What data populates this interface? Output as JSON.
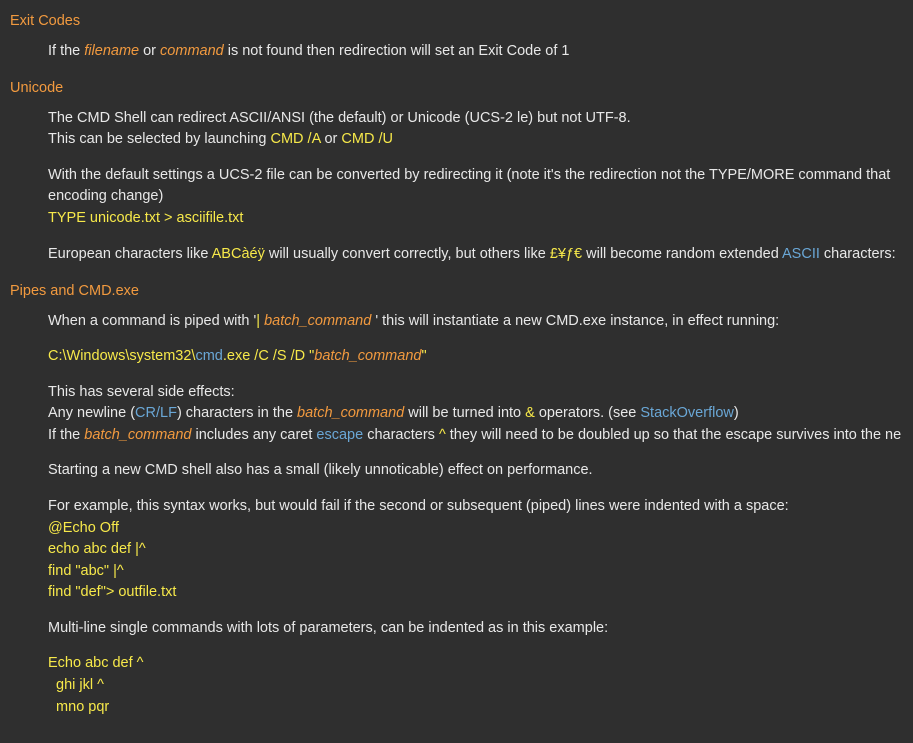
{
  "sections": {
    "exitCodes": {
      "title": "Exit Codes",
      "line1_a": "If the ",
      "filename": "filename",
      "line1_b": " or ",
      "command": "command",
      "line1_c": " is not found then redirection will set an Exit Code of 1"
    },
    "unicode": {
      "title": "Unicode",
      "p1": "The CMD Shell can redirect ASCII/ANSI (the default) or Unicode (UCS-2 le) but not UTF-8.",
      "p2_a": "This can be selected by launching ",
      "p2_cmdA": "CMD /A",
      "p2_or": " or ",
      "p2_cmdU": "CMD /U",
      "p3": "With the default settings a UCS-2 file can be converted by redirecting it (note it's the redirection not the TYPE/MORE command that",
      "p3b": "encoding change)",
      "typeLine": "TYPE unicode.txt > asciifile.txt",
      "p4_a": "European characters like ",
      "p4_abc": "ABCàéÿ",
      "p4_b": " will usually convert correctly, but others like ",
      "p4_cur": "£¥ƒ€",
      "p4_c": " will become random extended ",
      "p4_ascii": "ASCII",
      "p4_d": " characters: "
    },
    "pipes": {
      "title": "Pipes and CMD.exe",
      "p1_a": "When a command is piped with '",
      "p1_pipe": "| ",
      "p1_bc": "batch_command ",
      "p1_b": "' this will instantiate a new CMD.exe instance, in effect running:",
      "cmdline_a": "C:\\Windows\\system32\\",
      "cmdline_cmd": "cmd",
      "cmdline_b": ".exe /C /S /D \"",
      "cmdline_bc": "batch_command",
      "cmdline_c": "\"",
      "p2": "This has several side effects:",
      "p3_a": "Any newline (",
      "p3_crlf": "CR/LF",
      "p3_b": ") characters in the ",
      "p3_bc": "batch_command",
      "p3_c": " will be turned into ",
      "p3_amp": "&",
      "p3_d": " operators. (see ",
      "p3_so": "StackOverflow",
      "p3_e": ")",
      "p4_a": "If the ",
      "p4_bc": "batch_command",
      "p4_b": " includes any caret ",
      "p4_esc": "escape",
      "p4_c": " characters ",
      "p4_caret": "^",
      "p4_d": " they will need to be doubled up so that the escape survives into the ne",
      "p5": "Starting a new CMD shell also has a small (likely unnoticable) effect on performance.",
      "p6": "For example, this syntax works, but would fail if the second or subsequent (piped) lines were indented with a space:",
      "code1_l1": "@Echo Off",
      "code1_l2": "echo abc def |^",
      "code1_l3": "find \"abc\" |^",
      "code1_l4": "find \"def\"> outfile.txt",
      "p7": "Multi-line single commands with lots of parameters, can be indented as in this example:",
      "code2_l1": "Echo abc def ^",
      "code2_l2": "  ghi jkl ^",
      "code2_l3": "  mno pqr"
    }
  }
}
